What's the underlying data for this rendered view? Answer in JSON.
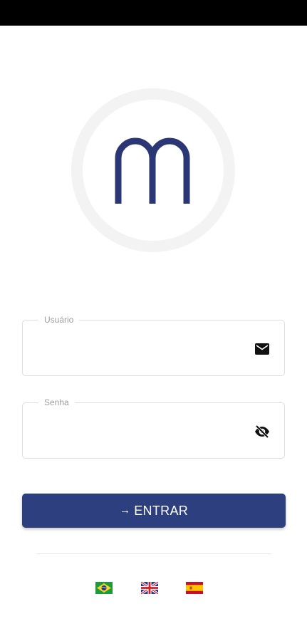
{
  "status_bar": {},
  "logo": {
    "letter": "m",
    "color": "#2a3774",
    "ring_color": "#f3f3f3"
  },
  "form": {
    "username": {
      "label": "Usuário",
      "value": "",
      "icon": "mail-icon"
    },
    "password": {
      "label": "Senha",
      "value": "",
      "icon": "eye-off-icon"
    },
    "submit": {
      "arrow": "→",
      "label": "ENTRAR",
      "color": "#2d3f7f"
    }
  },
  "languages": [
    {
      "code": "pt-BR",
      "icon": "brazil-flag-icon"
    },
    {
      "code": "en-GB",
      "icon": "uk-flag-icon"
    },
    {
      "code": "es-ES",
      "icon": "spain-flag-icon"
    }
  ]
}
